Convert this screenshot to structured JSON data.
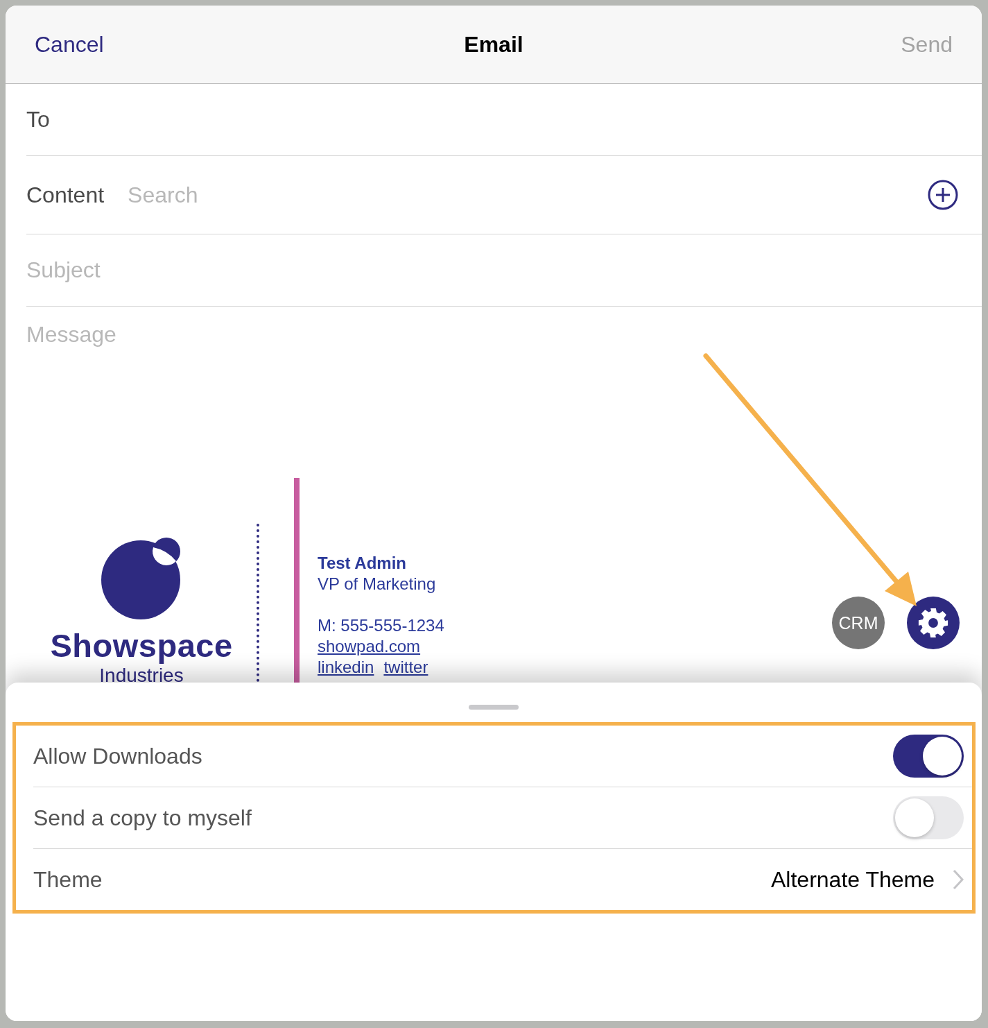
{
  "header": {
    "cancel": "Cancel",
    "title": "Email",
    "send": "Send",
    "send_disabled": true
  },
  "fields": [
    {
      "kind": "label",
      "label": "To"
    },
    {
      "kind": "search",
      "label": "Content",
      "placeholder": "Search"
    },
    {
      "kind": "input",
      "placeholder": "Subject"
    }
  ],
  "message": {
    "placeholder": "Message"
  },
  "signature": {
    "logo_name": "Showspace",
    "logo_sub": "Industries",
    "name": "Test Admin",
    "title": "VP of Marketing",
    "phone": "M: 555-555-1234",
    "website": "showpad.com",
    "social": [
      "linkedin",
      "twitter"
    ]
  },
  "actions": {
    "crm": "CRM"
  },
  "settings": [
    {
      "kind": "toggle",
      "label": "Allow Downloads",
      "on": true
    },
    {
      "kind": "toggle",
      "label": "Send a copy to myself",
      "on": false
    },
    {
      "kind": "link",
      "label": "Theme",
      "value": "Alternate Theme"
    }
  ]
}
